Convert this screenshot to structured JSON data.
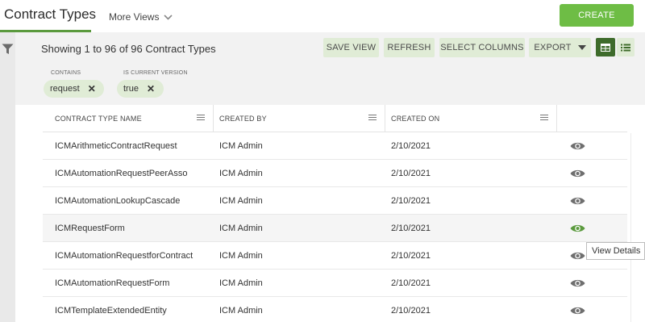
{
  "header": {
    "title": "Contract Types",
    "more_views": "More Views",
    "create_label": "CREATE"
  },
  "toolbar": {
    "showing": "Showing 1 to 96 of 96 Contract Types",
    "save_view": "SAVE VIEW",
    "refresh": "REFRESH",
    "select_columns": "SELECT COLUMNS",
    "export": "EXPORT"
  },
  "filters": [
    {
      "label": "CONTAINS",
      "value": "request"
    },
    {
      "label": "IS CURRENT VERSION",
      "value": "true"
    }
  ],
  "table": {
    "columns": [
      "CONTRACT TYPE NAME",
      "CREATED BY",
      "CREATED ON"
    ],
    "rows": [
      {
        "name": "ICMArithmeticContractRequest",
        "created_by": "ICM Admin",
        "created_on": "2/10/2021"
      },
      {
        "name": "ICMAutomationRequestPeerAsso",
        "created_by": "ICM Admin",
        "created_on": "2/10/2021"
      },
      {
        "name": "ICMAutomationLookupCascade",
        "created_by": "ICM Admin",
        "created_on": "2/10/2021"
      },
      {
        "name": "ICMRequestForm",
        "created_by": "ICM Admin",
        "created_on": "2/10/2021"
      },
      {
        "name": "ICMAutomationRequestforContract",
        "created_by": "ICM Admin",
        "created_on": "2/10/2021"
      },
      {
        "name": "ICMAutomationRequestForm",
        "created_by": "ICM Admin",
        "created_on": "2/10/2021"
      },
      {
        "name": "ICMTemplateExtendedEntity",
        "created_by": "ICM Admin",
        "created_on": "2/10/2021"
      }
    ]
  },
  "tooltip": "View Details",
  "colors": {
    "accent": "#6ebd45",
    "accent_dark": "#3e6b2b",
    "button_bg": "#e0ecd6",
    "eye_active": "#5b9a3e",
    "eye_default": "#6f6f6f"
  },
  "icons": {
    "filter": "filter-icon",
    "view_details": "eye-icon",
    "grid_view": "grid-view-icon",
    "list_view": "list-view-icon",
    "remove_filter": "close-icon",
    "column_menu": "menu-icon",
    "dropdown": "chevron-down-icon"
  }
}
